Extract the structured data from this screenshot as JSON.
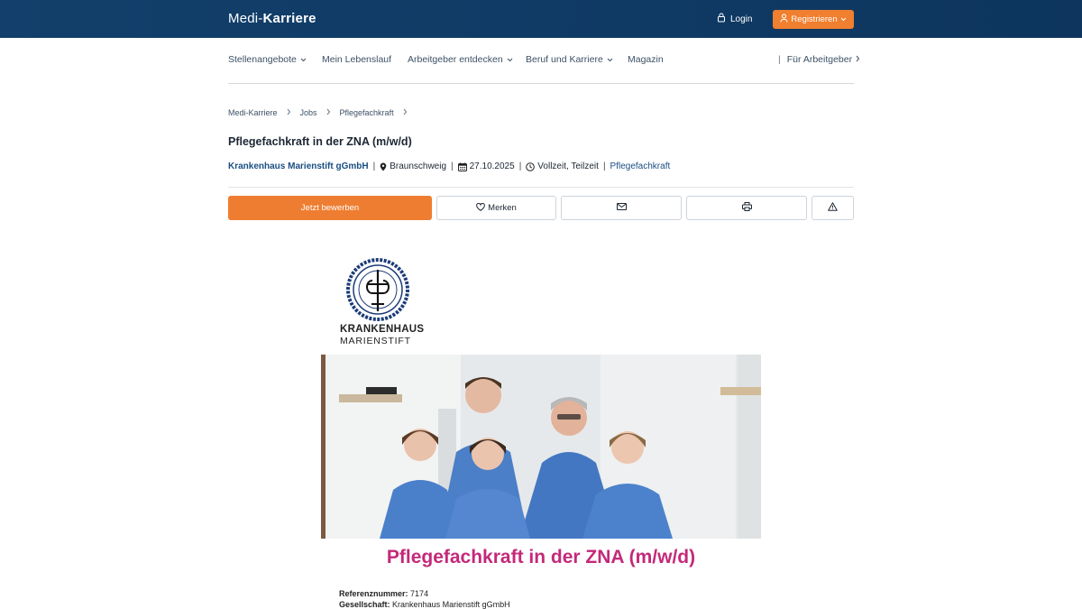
{
  "header": {
    "logo_part1": "Medi-",
    "logo_part2": "Karriere",
    "login_label": "Login",
    "register_label": "Registrieren"
  },
  "nav": {
    "items": [
      {
        "label": "Stellenangebote",
        "dropdown": true
      },
      {
        "label": "Mein Lebenslauf",
        "dropdown": false
      },
      {
        "label": "Arbeitgeber entdecken",
        "dropdown": true
      },
      {
        "label": "Beruf und Karriere",
        "dropdown": true
      },
      {
        "label": "Magazin",
        "dropdown": false
      }
    ],
    "employer_label": "Für Arbeitgeber"
  },
  "breadcrumb": [
    "Medi-Karriere",
    "Jobs",
    "Pflegefachkraft"
  ],
  "job": {
    "title": "Pflegefachkraft in der ZNA (m/w/d)",
    "company": "Krankenhaus Marienstift gGmbH",
    "location": "Braunschweig",
    "date": "27.10.2025",
    "employment": "Vollzeit, Teilzeit",
    "category": "Pflegefachkraft"
  },
  "actions": {
    "apply_label": "Jetzt bewerben",
    "save_label": "Merken"
  },
  "content": {
    "logo_line1": "KRANKENHAUS",
    "logo_line2": "MARIENSTIFT",
    "heading": "Pflegefachkraft in der ZNA (m/w/d)",
    "ref_label": "Referenznummer:",
    "ref_value": "7174",
    "company_label": "Gesellschaft:",
    "company_value": "Krankenhaus Marienstift gGmbH"
  },
  "colors": {
    "header_bg": "#123f6b",
    "accent_orange": "#ef7d31",
    "link_blue": "#1a4e82",
    "heading_magenta": "#c4297a"
  }
}
